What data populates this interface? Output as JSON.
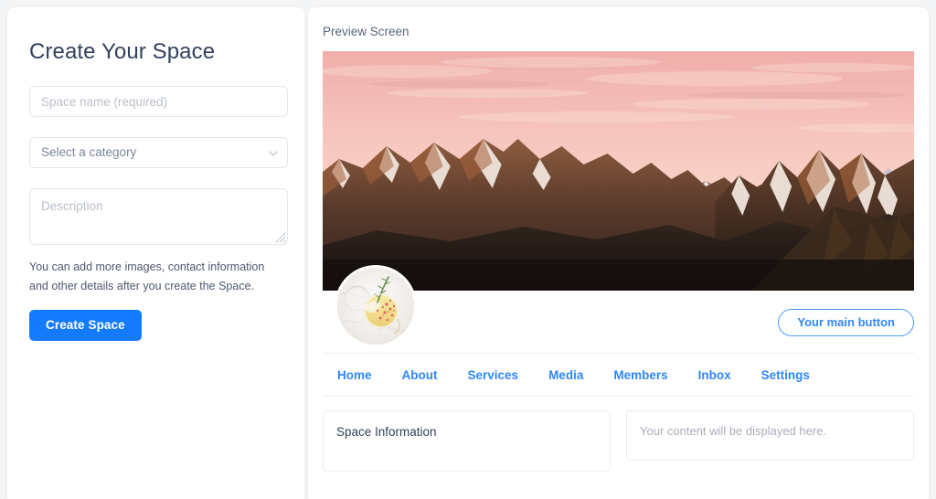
{
  "theme": {
    "page_bg": "#f4f5f7",
    "card_bg": "#ffffff",
    "primary_blue": "#147bff",
    "link_blue": "#2f87f7",
    "heading_color": "#33415c",
    "placeholder_color": "#b9bfc9",
    "border_color": "#e3e6ea"
  },
  "form": {
    "title": "Create Your Space",
    "space_name": {
      "value": "",
      "placeholder": "Space name (required)"
    },
    "category": {
      "selected_label": "Select a category",
      "chevron_icon": "chevron-down-icon"
    },
    "description": {
      "value": "",
      "placeholder": "Description",
      "resize_icon": "resize-handle-icon"
    },
    "helper_text": "You can add more images, contact information and other details after you create the Space.",
    "submit_label": "Create Space"
  },
  "preview": {
    "label": "Preview Screen",
    "banner": {
      "name": "hero-banner-image",
      "description": "Pink sunset sky over snow-capped mountain range",
      "sky_top": "#f2b8b5",
      "sky_mid": "#f7cfc6",
      "sky_low": "#f9ded2",
      "mountain_dark": "#2b211d",
      "mountain_lit": "#7a4a33",
      "snow": "#f6eee8"
    },
    "avatar": {
      "name": "space-avatar-image",
      "description": "Cocktail glass with rosemary sprig on marble surface"
    },
    "main_button_label": "Your main button",
    "nav_items": [
      {
        "label": "Home"
      },
      {
        "label": "About"
      },
      {
        "label": "Services"
      },
      {
        "label": "Media"
      },
      {
        "label": "Members"
      },
      {
        "label": "Inbox"
      },
      {
        "label": "Settings"
      }
    ],
    "info_card_title": "Space Information",
    "content_card_placeholder": "Your content will be displayed here."
  }
}
